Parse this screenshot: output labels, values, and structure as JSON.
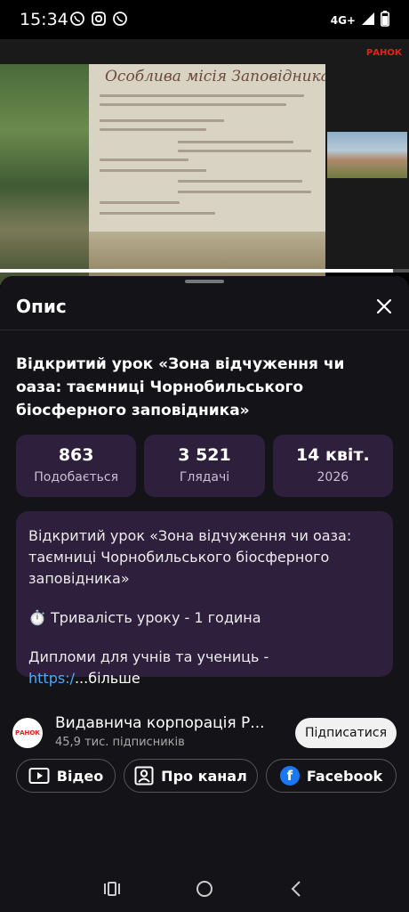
{
  "status_bar": {
    "time": "15:34",
    "network": "4G+",
    "icons": [
      "viber-icon",
      "instagram-icon",
      "viber-icon",
      "signal-icon",
      "battery-icon"
    ]
  },
  "video": {
    "slide_title": "Особлива місія Заповідника",
    "brand": "РАНОК"
  },
  "sheet": {
    "title": "Опис",
    "video_title": "Відкритий урок «Зона відчуження чи оаза: таємниці Чорнобильського біосферного заповідника»",
    "stats": [
      {
        "value": "863",
        "label": "Подобається"
      },
      {
        "value": "3 521",
        "label": "Глядачі"
      },
      {
        "value": "14 квіт.",
        "label": "2026"
      }
    ],
    "description": {
      "line1": "Відкритий урок «Зона відчуження чи оаза: таємниці Чорнобильського біосферного заповідника»",
      "line2": "⏱️ Тривалість уроку - 1 година",
      "line3_text": "Дипломи для учнів та учениць - ",
      "line3_link": "https:/",
      "more": "...більше"
    },
    "channel": {
      "name": "Видавнича корпорація Р...",
      "subscribers": "45,9 тис. підписників",
      "avatar_text": "РАНОК",
      "subscribe_label": "Підписатися"
    },
    "chips": {
      "video": "Відео",
      "about": "Про канал",
      "facebook": "Facebook"
    }
  },
  "colors": {
    "card_bg": "#2e1f3d",
    "link": "#4ea8ff",
    "brand_red": "#e0241b"
  }
}
